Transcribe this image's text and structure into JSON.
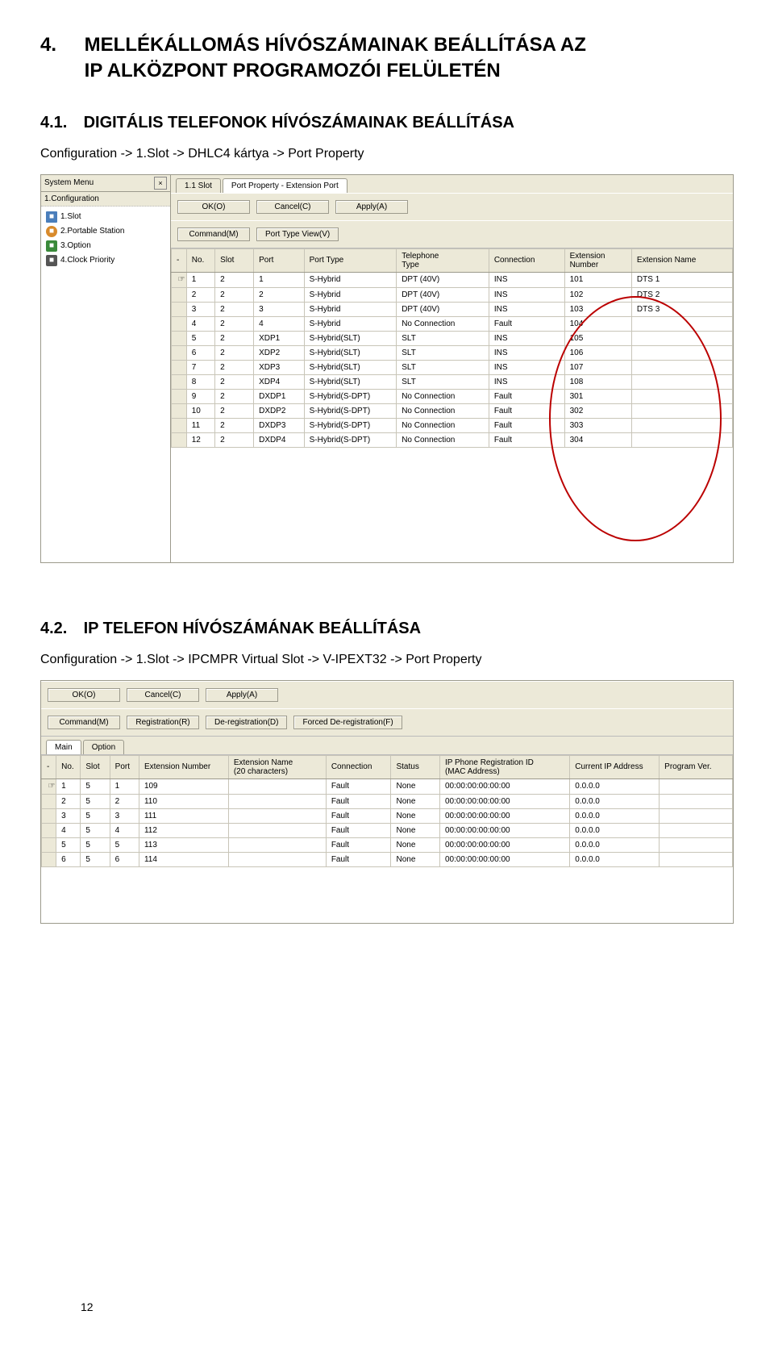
{
  "section": {
    "number": "4.",
    "title_line1": "MELLÉKÁLLOMÁS HÍVÓSZÁMAINAK BEÁLLÍTÁSA AZ",
    "title_line2": "IP ALKÖZPONT PROGRAMOZÓI FELÜLETÉN"
  },
  "sub1": {
    "number": "4.1.",
    "title": "DIGITÁLIS TELEFONOK HÍVÓSZÁMAINAK BEÁLLÍTÁSA",
    "path": "Configuration -> 1.Slot -> DHLC4 kártya -> Port Property"
  },
  "sub2": {
    "number": "4.2.",
    "title": "IP TELEFON HÍVÓSZÁMÁNAK BEÁLLÍTÁSA",
    "path": "Configuration -> 1.Slot -> IPCMPR Virtual Slot -> V-IPEXT32 -> Port Property"
  },
  "page_number": "12",
  "shot1": {
    "sidebar": {
      "header": "System Menu",
      "close": "×",
      "label": "1.Configuration",
      "items": [
        {
          "icon": "slot",
          "text": "1.Slot"
        },
        {
          "icon": "portable",
          "text": "2.Portable Station"
        },
        {
          "icon": "option",
          "text": "3.Option"
        },
        {
          "icon": "clock",
          "text": "4.Clock Priority"
        }
      ]
    },
    "tabs": [
      {
        "label": "1.1 Slot",
        "active": false
      },
      {
        "label": "Port Property - Extension Port",
        "active": true
      }
    ],
    "buttons_row1": [
      "OK(O)",
      "Cancel(C)",
      "Apply(A)"
    ],
    "buttons_row2": [
      "Command(M)",
      "Port Type View(V)"
    ],
    "columns": [
      "-",
      "No.",
      "Slot",
      "Port",
      "Port Type",
      "Telephone\nType",
      "Connection",
      "Extension\nNumber",
      "Extension Name"
    ],
    "col_widths": [
      "18px",
      "34px",
      "46px",
      "60px",
      "110px",
      "110px",
      "90px",
      "80px",
      "120px"
    ],
    "rows": [
      {
        "hand": true,
        "cells": [
          "1",
          "2",
          "1",
          "S-Hybrid",
          "DPT (40V)",
          "INS",
          "101",
          "DTS 1"
        ]
      },
      {
        "hand": false,
        "cells": [
          "2",
          "2",
          "2",
          "S-Hybrid",
          "DPT (40V)",
          "INS",
          "102",
          "DTS 2"
        ]
      },
      {
        "hand": false,
        "cells": [
          "3",
          "2",
          "3",
          "S-Hybrid",
          "DPT (40V)",
          "INS",
          "103",
          "DTS 3"
        ]
      },
      {
        "hand": false,
        "cells": [
          "4",
          "2",
          "4",
          "S-Hybrid",
          "No Connection",
          "Fault",
          "104",
          ""
        ]
      },
      {
        "hand": false,
        "cells": [
          "5",
          "2",
          "XDP1",
          "S-Hybrid(SLT)",
          "SLT",
          "INS",
          "105",
          ""
        ]
      },
      {
        "hand": false,
        "cells": [
          "6",
          "2",
          "XDP2",
          "S-Hybrid(SLT)",
          "SLT",
          "INS",
          "106",
          ""
        ]
      },
      {
        "hand": false,
        "cells": [
          "7",
          "2",
          "XDP3",
          "S-Hybrid(SLT)",
          "SLT",
          "INS",
          "107",
          ""
        ]
      },
      {
        "hand": false,
        "cells": [
          "8",
          "2",
          "XDP4",
          "S-Hybrid(SLT)",
          "SLT",
          "INS",
          "108",
          ""
        ]
      },
      {
        "hand": false,
        "cells": [
          "9",
          "2",
          "DXDP1",
          "S-Hybrid(S-DPT)",
          "No Connection",
          "Fault",
          "301",
          ""
        ]
      },
      {
        "hand": false,
        "cells": [
          "10",
          "2",
          "DXDP2",
          "S-Hybrid(S-DPT)",
          "No Connection",
          "Fault",
          "302",
          ""
        ]
      },
      {
        "hand": false,
        "cells": [
          "11",
          "2",
          "DXDP3",
          "S-Hybrid(S-DPT)",
          "No Connection",
          "Fault",
          "303",
          ""
        ]
      },
      {
        "hand": false,
        "cells": [
          "12",
          "2",
          "DXDP4",
          "S-Hybrid(S-DPT)",
          "No Connection",
          "Fault",
          "304",
          ""
        ]
      }
    ]
  },
  "shot2": {
    "buttons_row1": [
      "OK(O)",
      "Cancel(C)",
      "Apply(A)"
    ],
    "buttons_row2": [
      "Command(M)",
      "Registration(R)",
      "De-registration(D)",
      "Forced De-registration(F)"
    ],
    "tabs": [
      {
        "label": "Main",
        "active": true
      },
      {
        "label": "Option",
        "active": false
      }
    ],
    "columns": [
      "-",
      "No.",
      "Slot",
      "Port",
      "Extension Number",
      "Extension Name\n(20 characters)",
      "Connection",
      "Status",
      "IP Phone Registration ID\n(MAC Address)",
      "Current IP Address",
      "Program Ver."
    ],
    "col_widths": [
      "18px",
      "30px",
      "36px",
      "36px",
      "110px",
      "120px",
      "80px",
      "60px",
      "160px",
      "110px",
      "90px"
    ],
    "rows": [
      {
        "hand": true,
        "cells": [
          "1",
          "5",
          "1",
          "109",
          "",
          "Fault",
          "None",
          "00:00:00:00:00:00",
          "0.0.0.0",
          ""
        ]
      },
      {
        "hand": false,
        "cells": [
          "2",
          "5",
          "2",
          "110",
          "",
          "Fault",
          "None",
          "00:00:00:00:00:00",
          "0.0.0.0",
          ""
        ]
      },
      {
        "hand": false,
        "cells": [
          "3",
          "5",
          "3",
          "111",
          "",
          "Fault",
          "None",
          "00:00:00:00:00:00",
          "0.0.0.0",
          ""
        ]
      },
      {
        "hand": false,
        "cells": [
          "4",
          "5",
          "4",
          "112",
          "",
          "Fault",
          "None",
          "00:00:00:00:00:00",
          "0.0.0.0",
          ""
        ]
      },
      {
        "hand": false,
        "cells": [
          "5",
          "5",
          "5",
          "113",
          "",
          "Fault",
          "None",
          "00:00:00:00:00:00",
          "0.0.0.0",
          ""
        ]
      },
      {
        "hand": false,
        "cells": [
          "6",
          "5",
          "6",
          "114",
          "",
          "Fault",
          "None",
          "00:00:00:00:00:00",
          "0.0.0.0",
          ""
        ]
      }
    ]
  }
}
